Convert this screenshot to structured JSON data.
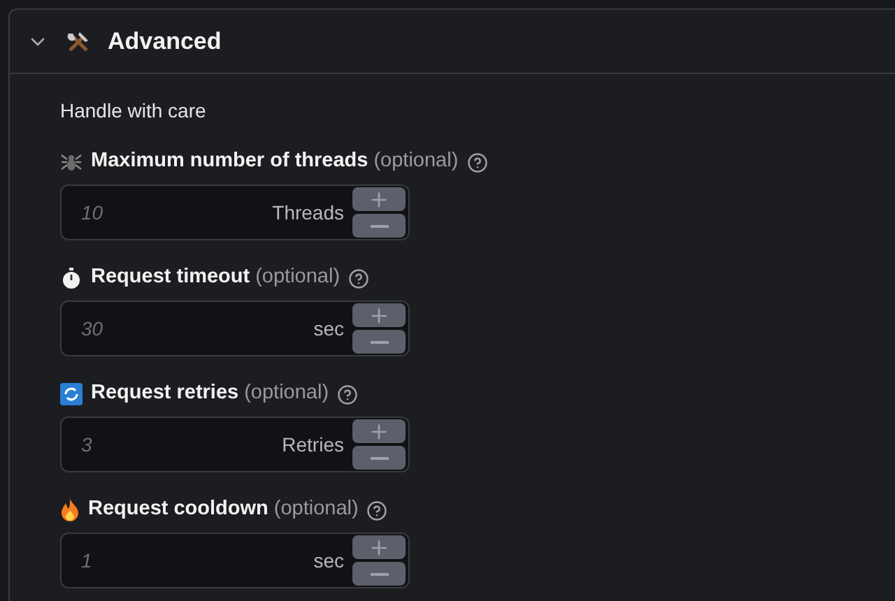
{
  "section": {
    "title": "Advanced",
    "expanded": true,
    "description": "Handle with care"
  },
  "fields": [
    {
      "kind": "threads",
      "label": "Maximum number of threads",
      "hint": "(optional)",
      "placeholder": "10",
      "unit": "Threads"
    },
    {
      "kind": "timeout",
      "label": "Request timeout",
      "hint": "(optional)",
      "placeholder": "30",
      "unit": "sec"
    },
    {
      "kind": "retries",
      "label": "Request retries",
      "hint": "(optional)",
      "placeholder": "3",
      "unit": "Retries"
    },
    {
      "kind": "cooldown",
      "label": "Request cooldown",
      "hint": "(optional)",
      "placeholder": "1",
      "unit": "sec"
    }
  ]
}
